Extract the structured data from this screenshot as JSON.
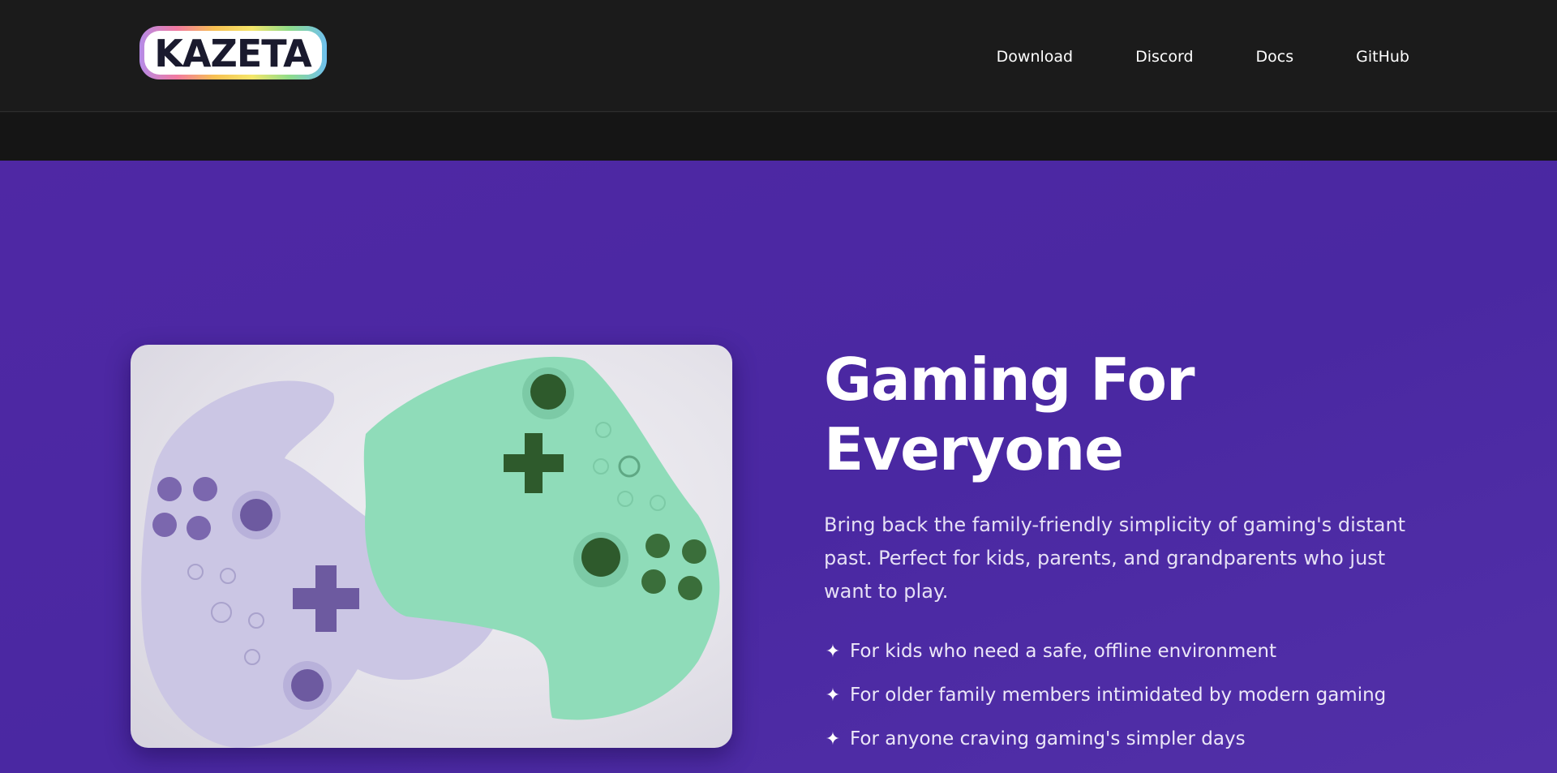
{
  "header": {
    "logo_text": "KAZETA",
    "nav": [
      {
        "label": "Download",
        "icon": null
      },
      {
        "label": "Discord",
        "icon": null
      },
      {
        "label": "Docs",
        "icon": null
      },
      {
        "label": "GitHub",
        "icon": null
      }
    ]
  },
  "hero": {
    "title_line1": "Gaming For",
    "title_line2": "Everyone",
    "description": "Bring back the family-friendly simplicity of gaming's distant past. Perfect for kids, parents, and grandparents who just want to play.",
    "features": [
      "For kids who need a safe, offline environment",
      "For older family members intimidated by modern gaming",
      "For anyone craving gaming's simpler days"
    ],
    "feature_icon": "sparkle-icon"
  },
  "colors": {
    "header_bg": "#1b1b1b",
    "hero_bg": "#4e28a4",
    "controller_purple": "#c9c4e4",
    "controller_green": "#8fdcb9"
  }
}
